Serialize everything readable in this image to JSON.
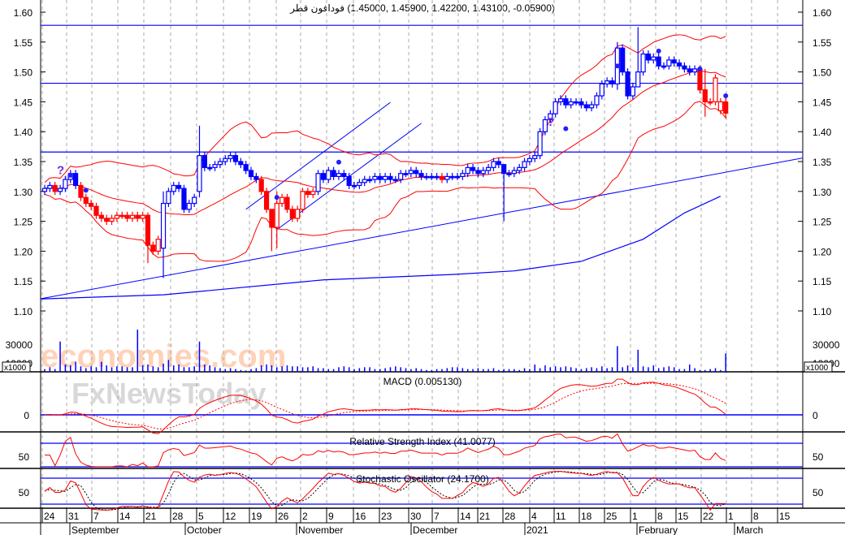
{
  "header": {
    "instrument_name": "فودافون قطر",
    "ohlc_readout": "(1.45000, 1.45900, 1.42200, 1.43100, -0.05900)"
  },
  "watermark": {
    "line1": "economies.com",
    "line2": "FxNewsToday"
  },
  "colors": {
    "bull": "#0000ff",
    "bear": "#ff0000",
    "band": "#ff0000",
    "level": "#0000ff",
    "grid": "#aaaaaa"
  },
  "chart_data": {
    "type": "candlestick",
    "title": "فودافون قطر (1.45000, 1.45900, 1.42200, 1.43100, -0.05900)",
    "ylim": [
      1.08,
      1.62
    ],
    "yticks": [
      "1.60",
      "1.55",
      "1.50",
      "1.45",
      "1.40",
      "1.35",
      "1.30",
      "1.25",
      "1.20",
      "1.15",
      "1.10"
    ],
    "xticks": [
      "24",
      "31",
      "7",
      "14",
      "21",
      "28",
      "5",
      "12",
      "19",
      "26",
      "2",
      "9",
      "16",
      "23",
      "30",
      "7",
      "14",
      "21",
      "28",
      "4",
      "11",
      "18",
      "25",
      "1",
      "8",
      "15",
      "22",
      "1",
      "8",
      "15"
    ],
    "months": [
      "September",
      "October",
      "November",
      "December",
      "2021",
      "February",
      "March"
    ],
    "open": [
      1.3,
      1.305,
      1.31,
      1.3,
      1.305,
      1.32,
      1.33,
      1.31,
      1.29,
      1.28,
      1.275,
      1.26,
      1.255,
      1.25,
      1.255,
      1.26,
      1.26,
      1.255,
      1.26,
      1.255,
      1.26,
      1.21,
      1.2,
      1.205,
      1.28,
      1.3,
      1.31,
      1.305,
      1.27,
      1.28,
      1.3,
      1.36,
      1.34,
      1.34,
      1.345,
      1.35,
      1.355,
      1.36,
      1.35,
      1.345,
      1.335,
      1.325,
      1.32,
      1.3,
      1.27,
      1.24,
      1.28,
      1.29,
      1.27,
      1.255,
      1.27,
      1.3,
      1.295,
      1.3,
      1.33,
      1.32,
      1.335,
      1.325,
      1.33,
      1.325,
      1.31,
      1.31,
      1.315,
      1.32,
      1.32,
      1.325,
      1.32,
      1.325,
      1.32,
      1.32,
      1.33,
      1.33,
      1.335,
      1.33,
      1.325,
      1.325,
      1.325,
      1.325,
      1.32,
      1.325,
      1.325,
      1.325,
      1.33,
      1.34,
      1.335,
      1.33,
      1.335,
      1.34,
      1.35,
      1.345,
      1.33,
      1.33,
      1.335,
      1.34,
      1.35,
      1.355,
      1.36,
      1.4,
      1.42,
      1.43,
      1.45,
      1.455,
      1.445,
      1.45,
      1.45,
      1.445,
      1.44,
      1.445,
      1.46,
      1.48,
      1.485,
      1.48,
      1.54,
      1.5,
      1.46,
      1.475,
      1.5,
      1.53,
      1.52,
      1.525,
      1.51,
      1.51,
      1.52,
      1.515,
      1.51,
      1.505,
      1.5,
      1.505,
      1.47,
      1.45,
      1.45,
      1.435,
      1.45
    ],
    "close": [
      1.305,
      1.31,
      1.3,
      1.305,
      1.32,
      1.33,
      1.31,
      1.29,
      1.28,
      1.275,
      1.26,
      1.255,
      1.25,
      1.255,
      1.26,
      1.26,
      1.255,
      1.26,
      1.255,
      1.26,
      1.21,
      1.2,
      1.22,
      1.28,
      1.3,
      1.31,
      1.305,
      1.27,
      1.28,
      1.29,
      1.36,
      1.34,
      1.34,
      1.345,
      1.35,
      1.355,
      1.36,
      1.35,
      1.345,
      1.335,
      1.325,
      1.32,
      1.3,
      1.27,
      1.24,
      1.28,
      1.29,
      1.27,
      1.255,
      1.27,
      1.3,
      1.295,
      1.3,
      1.33,
      1.32,
      1.335,
      1.325,
      1.33,
      1.325,
      1.31,
      1.31,
      1.315,
      1.32,
      1.32,
      1.325,
      1.32,
      1.325,
      1.32,
      1.32,
      1.33,
      1.33,
      1.335,
      1.33,
      1.325,
      1.325,
      1.325,
      1.325,
      1.32,
      1.325,
      1.325,
      1.325,
      1.33,
      1.34,
      1.335,
      1.33,
      1.335,
      1.34,
      1.35,
      1.345,
      1.33,
      1.33,
      1.335,
      1.34,
      1.35,
      1.355,
      1.36,
      1.4,
      1.42,
      1.43,
      1.45,
      1.455,
      1.445,
      1.45,
      1.45,
      1.445,
      1.44,
      1.445,
      1.46,
      1.48,
      1.485,
      1.48,
      1.54,
      1.5,
      1.46,
      1.475,
      1.5,
      1.53,
      1.52,
      1.525,
      1.51,
      1.51,
      1.52,
      1.515,
      1.51,
      1.505,
      1.5,
      1.505,
      1.47,
      1.45,
      1.45,
      1.49,
      1.45,
      1.431
    ],
    "wick_overrides": {
      "20": [
        1.265,
        1.18
      ],
      "23": [
        1.3,
        1.155
      ],
      "30": [
        1.41,
        1.29
      ],
      "44": [
        1.27,
        1.2
      ],
      "45": [
        1.3,
        1.205
      ],
      "89": [
        1.345,
        1.25
      ],
      "111": [
        1.55,
        1.47
      ],
      "115": [
        1.575,
        1.5
      ],
      "128": [
        1.505,
        1.425
      ],
      "132": [
        1.459,
        1.422
      ]
    },
    "markers": [
      {
        "i": 3,
        "price": 1.337,
        "type": "question"
      },
      {
        "i": 5,
        "price": 1.327,
        "type": "dot"
      },
      {
        "i": 8,
        "price": 1.302,
        "type": "dot"
      },
      {
        "i": 45,
        "price": 1.29,
        "type": "dot"
      },
      {
        "i": 57,
        "price": 1.349,
        "type": "dot"
      },
      {
        "i": 98,
        "price": 1.418,
        "type": "question"
      },
      {
        "i": 101,
        "price": 1.405,
        "type": "dot"
      },
      {
        "i": 111,
        "price": 1.51,
        "type": "dot"
      },
      {
        "i": 119,
        "price": 1.535,
        "type": "dot"
      },
      {
        "i": 127,
        "price": 1.505,
        "type": "dot"
      },
      {
        "i": 132,
        "price": 1.46,
        "type": "dot"
      }
    ],
    "long_ma": [
      [
        -1,
        1.12
      ],
      [
        23,
        1.127
      ],
      [
        54,
        1.152
      ],
      [
        79,
        1.161
      ],
      [
        91,
        1.167
      ],
      [
        104,
        1.183
      ],
      [
        116,
        1.22
      ],
      [
        124,
        1.264
      ],
      [
        131,
        1.292
      ]
    ],
    "levels": [
      1.578,
      1.481,
      1.366
    ],
    "trendlines": [
      [
        [
          -1,
          1.12
        ],
        [
          147,
          1.356
        ]
      ],
      [
        [
          39,
          1.27
        ],
        [
          67,
          1.449
        ]
      ],
      [
        [
          45,
          1.236
        ],
        [
          73,
          1.414
        ]
      ]
    ],
    "volume": [
      3000,
      5000,
      3000,
      33000,
      8000,
      7000,
      11000,
      6000,
      4000,
      6000,
      5000,
      11000,
      7000,
      5000,
      6000,
      6000,
      5000,
      5000,
      46000,
      7000,
      8000,
      6000,
      5000,
      9000,
      13000,
      7000,
      8000,
      5000,
      5000,
      6000,
      33000,
      8000,
      7000,
      5000,
      4000,
      3000,
      4000,
      3000,
      2000,
      1500,
      3000,
      4000,
      7000,
      8000,
      7000,
      5000,
      6000,
      7000,
      6000,
      6000,
      5000,
      5000,
      6000,
      4000,
      4000,
      3000,
      3000,
      5000,
      6000,
      5000,
      3000,
      4000,
      5000,
      5000,
      3000,
      3000,
      4000,
      5000,
      6000,
      5000,
      4000,
      3000,
      4000,
      3000,
      2000,
      2000,
      3000,
      3000,
      4000,
      5000,
      5000,
      4000,
      3000,
      3000,
      4000,
      3000,
      3000,
      4000,
      2000,
      3000,
      3000,
      3000,
      2000,
      4000,
      3000,
      8000,
      4000,
      7000,
      5000,
      6000,
      5000,
      6000,
      5000,
      4000,
      3000,
      4000,
      5000,
      4000,
      6000,
      4000,
      5000,
      28000,
      5000,
      7000,
      5000,
      24000,
      6000,
      5000,
      7000,
      4000,
      5000,
      6000,
      5000,
      3000,
      3000,
      8000,
      4000,
      2000,
      2000,
      3000,
      4000,
      2000,
      20000
    ],
    "volume_ticks": [
      "30000",
      "10000"
    ],
    "volume_unit": "x1000",
    "macd": {
      "label": "MACD (0.005130)",
      "tick": "0"
    },
    "rsi": {
      "label": "Relative Strength Index (41.0077)",
      "tick": "50",
      "levels": [
        70,
        30
      ]
    },
    "stochastic": {
      "label": "Stochastic Oscillator (24.1700)",
      "tick": "50",
      "levels": [
        80,
        20
      ]
    }
  }
}
